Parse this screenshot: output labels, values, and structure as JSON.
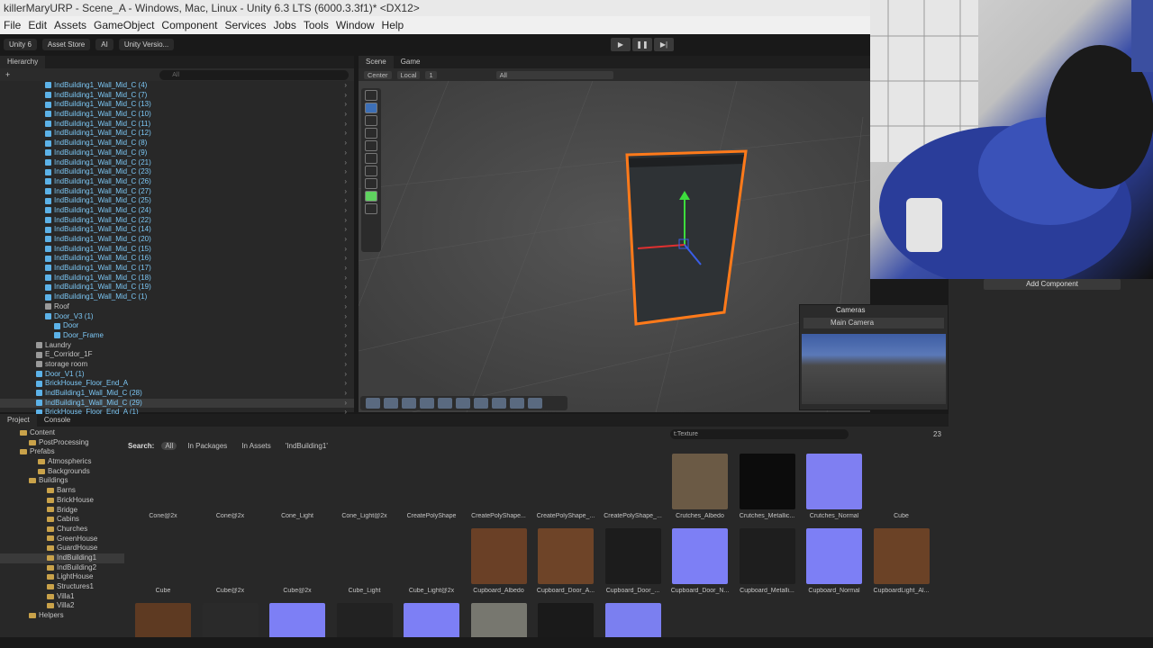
{
  "title": "killerMaryURP - Scene_A - Windows, Mac, Linux - Unity 6.3 LTS (6000.3.3f1)* <DX12>",
  "menu": [
    "File",
    "Edit",
    "Assets",
    "GameObject",
    "Component",
    "Services",
    "Jobs",
    "Tools",
    "Window",
    "Help"
  ],
  "toolbar": {
    "account": "Unity 6",
    "asset_store": "Asset Store",
    "ai": "AI",
    "version": "Unity Versio..."
  },
  "hierarchy": {
    "tab": "Hierarchy",
    "search_placeholder": "All",
    "rows": [
      {
        "label": "IndBuilding1_Wall_Mid_C (4)",
        "blue": true,
        "indent": 50
      },
      {
        "label": "IndBuilding1_Wall_Mid_C (7)",
        "blue": true,
        "indent": 50
      },
      {
        "label": "IndBuilding1_Wall_Mid_C (13)",
        "blue": true,
        "indent": 50
      },
      {
        "label": "IndBuilding1_Wall_Mid_C (10)",
        "blue": true,
        "indent": 50
      },
      {
        "label": "IndBuilding1_Wall_Mid_C (11)",
        "blue": true,
        "indent": 50
      },
      {
        "label": "IndBuilding1_Wall_Mid_C (12)",
        "blue": true,
        "indent": 50
      },
      {
        "label": "IndBuilding1_Wall_Mid_C (8)",
        "blue": true,
        "indent": 50
      },
      {
        "label": "IndBuilding1_Wall_Mid_C (9)",
        "blue": true,
        "indent": 50
      },
      {
        "label": "IndBuilding1_Wall_Mid_C (21)",
        "blue": true,
        "indent": 50
      },
      {
        "label": "IndBuilding1_Wall_Mid_C (23)",
        "blue": true,
        "indent": 50
      },
      {
        "label": "IndBuilding1_Wall_Mid_C (26)",
        "blue": true,
        "indent": 50
      },
      {
        "label": "IndBuilding1_Wall_Mid_C (27)",
        "blue": true,
        "indent": 50
      },
      {
        "label": "IndBuilding1_Wall_Mid_C (25)",
        "blue": true,
        "indent": 50
      },
      {
        "label": "IndBuilding1_Wall_Mid_C (24)",
        "blue": true,
        "indent": 50
      },
      {
        "label": "IndBuilding1_Wall_Mid_C (22)",
        "blue": true,
        "indent": 50
      },
      {
        "label": "IndBuilding1_Wall_Mid_C (14)",
        "blue": true,
        "indent": 50
      },
      {
        "label": "IndBuilding1_Wall_Mid_C (20)",
        "blue": true,
        "indent": 50
      },
      {
        "label": "IndBuilding1_Wall_Mid_C (15)",
        "blue": true,
        "indent": 50
      },
      {
        "label": "IndBuilding1_Wall_Mid_C (16)",
        "blue": true,
        "indent": 50
      },
      {
        "label": "IndBuilding1_Wall_Mid_C (17)",
        "blue": true,
        "indent": 50
      },
      {
        "label": "IndBuilding1_Wall_Mid_C (18)",
        "blue": true,
        "indent": 50
      },
      {
        "label": "IndBuilding1_Wall_Mid_C (19)",
        "blue": true,
        "indent": 50
      },
      {
        "label": "IndBuilding1_Wall_Mid_C (1)",
        "blue": true,
        "indent": 50
      },
      {
        "label": "Roof",
        "blue": false,
        "indent": 50
      },
      {
        "label": "Door_V3 (1)",
        "blue": true,
        "indent": 50
      },
      {
        "label": "Door",
        "blue": true,
        "indent": 60
      },
      {
        "label": "Door_Frame",
        "blue": true,
        "indent": 60
      },
      {
        "label": "Laundry",
        "blue": false,
        "indent": 40
      },
      {
        "label": "E_Corridor_1F",
        "blue": false,
        "indent": 40
      },
      {
        "label": "storage room",
        "blue": false,
        "indent": 40
      },
      {
        "label": "Door_V1 (1)",
        "blue": true,
        "indent": 40
      },
      {
        "label": "BrickHouse_Floor_End_A",
        "blue": true,
        "indent": 40
      },
      {
        "label": "IndBuilding1_Wall_Mid_C (28)",
        "blue": true,
        "indent": 40
      },
      {
        "label": "IndBuilding1_Wall_Mid_C (29)",
        "blue": true,
        "indent": 40,
        "selected": true
      },
      {
        "label": "BrickHouse_Floor_End_A (1)",
        "blue": true,
        "indent": 40
      }
    ]
  },
  "scene": {
    "tabs": [
      "Scene",
      "Game"
    ],
    "pivot": "Center",
    "space": "Local",
    "grid_snap": "1",
    "search_placeholder": "All"
  },
  "cameras": {
    "title": "Cameras",
    "selected": "Main Camera"
  },
  "inspector": {
    "add_component": "Add Component"
  },
  "project": {
    "tabs": [
      "Project",
      "Console"
    ],
    "tree": [
      {
        "label": "Content",
        "indent": 22
      },
      {
        "label": "PostProcessing",
        "indent": 32
      },
      {
        "label": "Prefabs",
        "indent": 22
      },
      {
        "label": "Atmospherics",
        "indent": 42
      },
      {
        "label": "Backgrounds",
        "indent": 42
      },
      {
        "label": "Buildings",
        "indent": 32
      },
      {
        "label": "Barns",
        "indent": 52
      },
      {
        "label": "BrickHouse",
        "indent": 52
      },
      {
        "label": "Bridge",
        "indent": 52
      },
      {
        "label": "Cabins",
        "indent": 52
      },
      {
        "label": "Churches",
        "indent": 52
      },
      {
        "label": "GreenHouse",
        "indent": 52
      },
      {
        "label": "GuardHouse",
        "indent": 52
      },
      {
        "label": "IndBuilding1",
        "indent": 52,
        "selected": true
      },
      {
        "label": "IndBuilding2",
        "indent": 52
      },
      {
        "label": "LightHouse",
        "indent": 52
      },
      {
        "label": "Structures1",
        "indent": 52
      },
      {
        "label": "Villa1",
        "indent": 52
      },
      {
        "label": "Villa2",
        "indent": 52
      },
      {
        "label": "Helpers",
        "indent": 32
      }
    ],
    "search_label": "Search:",
    "filters": [
      "All",
      "In Packages",
      "In Assets",
      "'IndBuilding1'"
    ],
    "type_filter": "t:Texture",
    "count": "23",
    "assets": [
      {
        "label": "Cone@2x",
        "color": "#282828"
      },
      {
        "label": "Cone@2x",
        "color": "#282828"
      },
      {
        "label": "Cone_Light",
        "color": "#282828"
      },
      {
        "label": "Cone_Light@2x",
        "color": "#282828"
      },
      {
        "label": "CreatePolyShape",
        "color": "#282828"
      },
      {
        "label": "CreatePolyShape...",
        "color": "#282828"
      },
      {
        "label": "CreatePolyShape_...",
        "color": "#282828"
      },
      {
        "label": "CreatePolyShape_...",
        "color": "#282828"
      },
      {
        "label": "Crutches_Albedo",
        "color": "#6b5a45"
      },
      {
        "label": "Crutches_Metallic...",
        "color": "#0c0c0c"
      },
      {
        "label": "Crutches_Normal",
        "color": "#7f7ff2"
      },
      {
        "label": "Cube",
        "color": "#282828"
      },
      {
        "label": "Cube",
        "color": "#282828"
      },
      {
        "label": "Cube@2x",
        "color": "#282828"
      },
      {
        "label": "Cube@2x",
        "color": "#282828"
      },
      {
        "label": "Cube_Light",
        "color": "#282828"
      },
      {
        "label": "Cube_Light@2x",
        "color": "#282828"
      },
      {
        "label": "Cupboard_Albedo",
        "color": "#6a4026"
      },
      {
        "label": "Cupboard_Door_A...",
        "color": "#6e4428"
      },
      {
        "label": "Cupboard_Door_...",
        "color": "#1c1c1c"
      },
      {
        "label": "Cupboard_Door_N...",
        "color": "#7d7ff5"
      },
      {
        "label": "Cupboard_Metalli...",
        "color": "#1e1e1e"
      },
      {
        "label": "Cupboard_Normal",
        "color": "#7d7ff5"
      },
      {
        "label": "CupboardLight_Al...",
        "color": "#6b4226"
      }
    ],
    "row3_colors": [
      "#5e3a22",
      "#2a2a2a",
      "#7d7ff5",
      "#222222",
      "#7d7ff5",
      "#77776f",
      "#1a1a1a",
      "#7b7ff0",
      "#282828",
      "#282828",
      "#282828",
      "#282828"
    ]
  }
}
